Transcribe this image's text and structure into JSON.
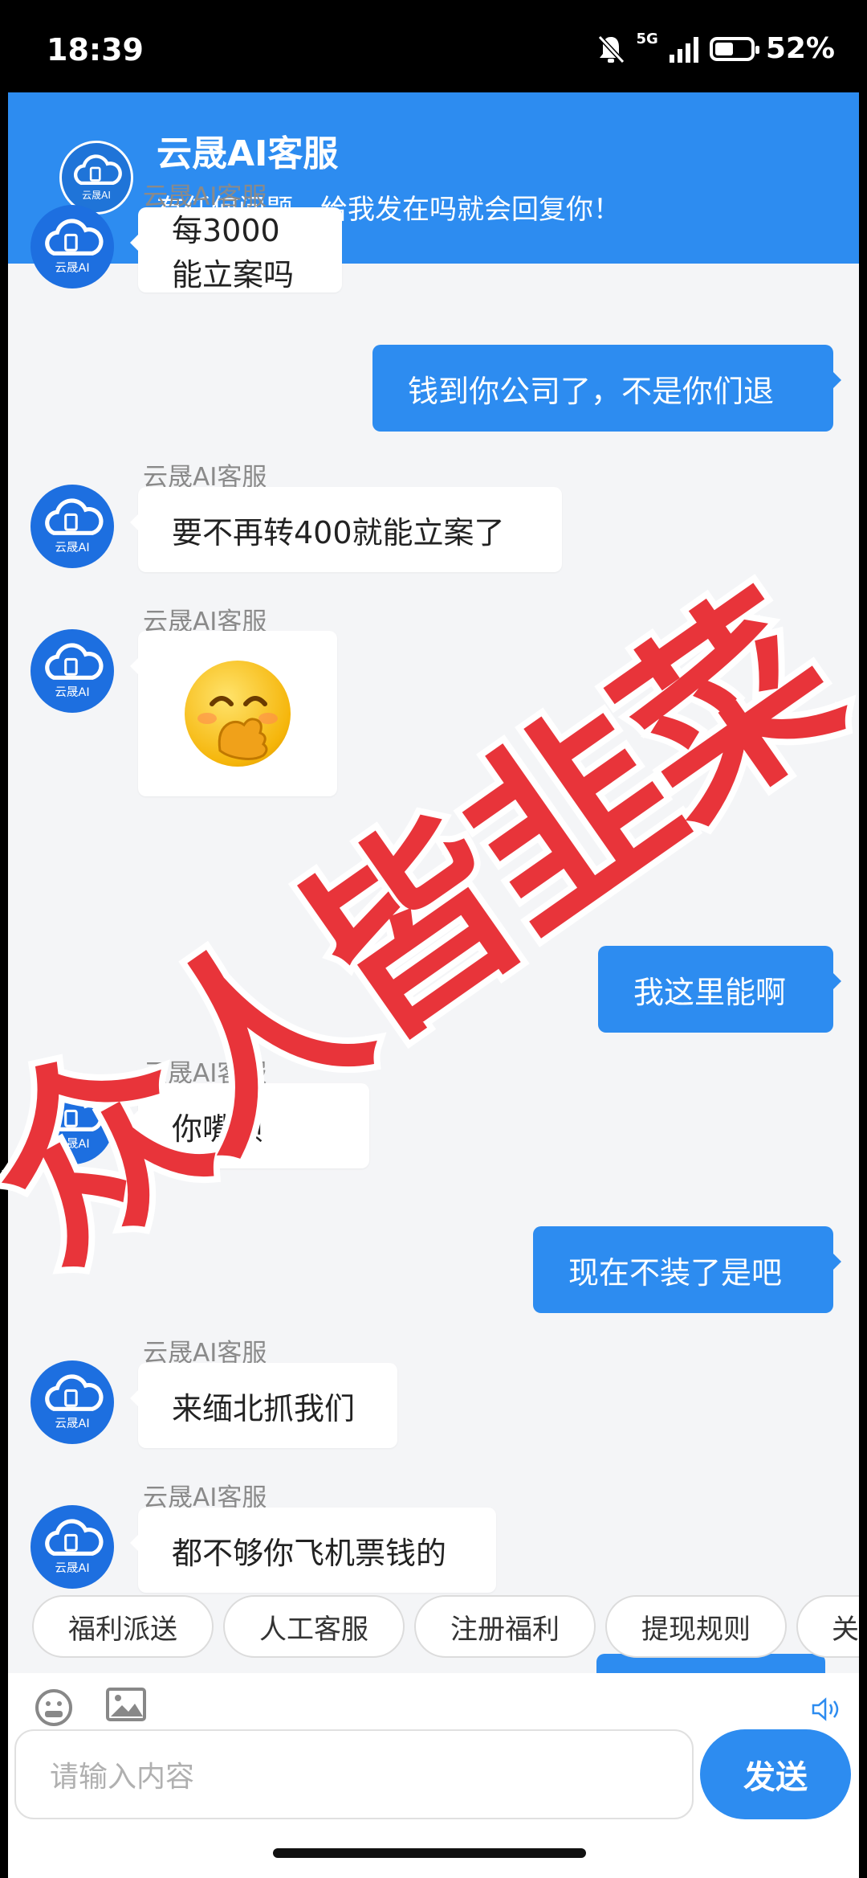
{
  "status_bar": {
    "time": "18:39",
    "network": "5G",
    "battery": "52%",
    "battery_level": 0.52
  },
  "header": {
    "title": "云晟AI客服",
    "subtitle": "有任何问题，给我发在吗就会回复你！",
    "logo_text": "云晟AI"
  },
  "messages": [
    {
      "from": "agent",
      "sender": "云晟AI客服",
      "text": "每3000能立案吗"
    },
    {
      "from": "user",
      "text": "钱到你公司了，不是你们退"
    },
    {
      "from": "agent",
      "sender": "云晟AI客服",
      "text": "要不再转400就能立案了"
    },
    {
      "from": "agent",
      "sender": "云晟AI客服",
      "emoji": "face-with-hand-over-mouth"
    },
    {
      "from": "user",
      "text": "我这里能啊"
    },
    {
      "from": "agent",
      "sender": "云晟AI客服",
      "text": "你嘴呗"
    },
    {
      "from": "user",
      "text": "现在不装了是吧"
    },
    {
      "from": "agent",
      "sender": "云晟AI客服",
      "text": "来缅北抓我们"
    },
    {
      "from": "agent",
      "sender": "云晟AI客服",
      "text": "都不够你飞机票钱的"
    }
  ],
  "quick_replies": [
    "福利派送",
    "人工客服",
    "注册福利",
    "提现规则",
    "关"
  ],
  "input": {
    "placeholder": "请输入内容",
    "send_label": "发送"
  },
  "watermark": {
    "text": "众人皆韭菜",
    "color": "#e8343a"
  },
  "colors": {
    "primary": "#2d8cf0",
    "background": "#f4f5f7"
  }
}
